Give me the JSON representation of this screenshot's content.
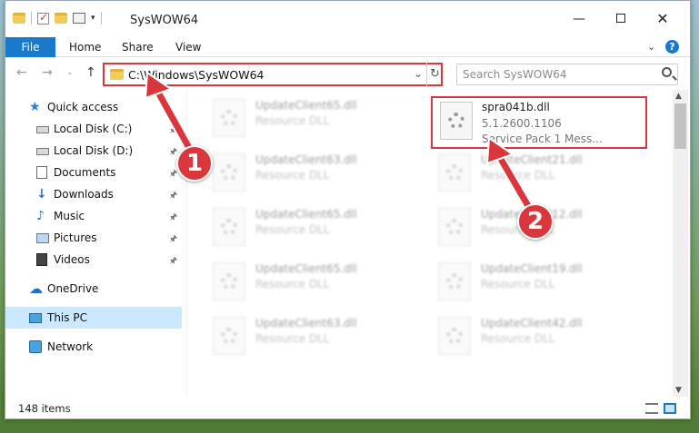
{
  "window": {
    "title": "SysWOW64"
  },
  "ribbon": {
    "tabs": [
      "File",
      "Home",
      "Share",
      "View"
    ],
    "help": "?"
  },
  "nav": {
    "address": "C:\\Windows\\SysWOW64",
    "search_placeholder": "Search SysWOW64"
  },
  "sidebar": {
    "quick_access": "Quick access",
    "items": [
      {
        "label": "Local Disk (C:)",
        "icon": "drive-icon"
      },
      {
        "label": "Local Disk (D:)",
        "icon": "drive-icon"
      },
      {
        "label": "Documents",
        "icon": "documents-icon"
      },
      {
        "label": "Downloads",
        "icon": "downloads-icon"
      },
      {
        "label": "Music",
        "icon": "music-icon"
      },
      {
        "label": "Pictures",
        "icon": "pictures-icon"
      },
      {
        "label": "Videos",
        "icon": "videos-icon"
      }
    ],
    "onedrive": "OneDrive",
    "this_pc": "This PC",
    "network": "Network"
  },
  "files": {
    "highlighted": {
      "name": "spra041b.dll",
      "version": "5.1.2600.1106",
      "description": "Service Pack 1 Mess..."
    },
    "left_column": [
      {
        "name": "UpdateClient65.dll",
        "type": "Resource DLL"
      },
      {
        "name": "UpdateClient63.dll",
        "type": "Resource DLL"
      },
      {
        "name": "UpdateClient65.dll",
        "type": "Resource DLL"
      },
      {
        "name": "UpdateClient65.dll",
        "type": "Resource DLL"
      },
      {
        "name": "UpdateClient63.dll",
        "type": "Resource DLL"
      }
    ],
    "right_column": [
      {
        "name": "UpdateClient21.dll",
        "type": "Resource DLL"
      },
      {
        "name": "UpdateClient12.dll",
        "type": "Resource DLL"
      },
      {
        "name": "UpdateClient19.dll",
        "type": "Resource DLL"
      },
      {
        "name": "UpdateClient42.dll",
        "type": "Resource DLL"
      }
    ]
  },
  "status": {
    "count": "148 items"
  },
  "annotations": {
    "step1": "1",
    "step2": "2",
    "color": "#d9373b"
  }
}
